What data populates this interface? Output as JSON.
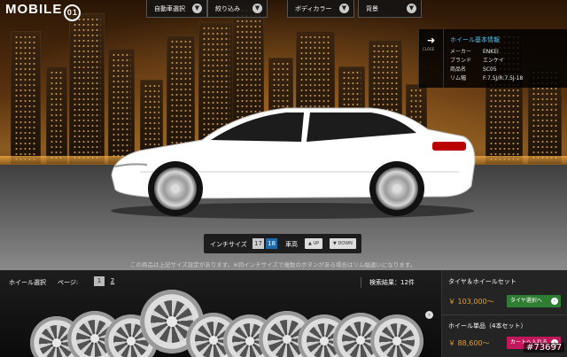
{
  "logo": {
    "text": "MOBILE",
    "badge": "01"
  },
  "topnav": [
    {
      "label": "自動車選択",
      "icon": "chevron-down-icon"
    },
    {
      "label": "絞り込み",
      "icon": "chevron-down-icon"
    },
    {
      "label": "ボディカラー",
      "icon": "chevron-down-icon"
    },
    {
      "label": "背景",
      "icon": "chevron-down-icon"
    }
  ],
  "info_panel": {
    "close_label": "CLOSE",
    "title": "ホイール基本情報",
    "rows": [
      {
        "key": "メーカー",
        "value": "ENKEI"
      },
      {
        "key": "ブランド",
        "value": "エンケイ"
      },
      {
        "key": "商品名",
        "value": "SC05"
      },
      {
        "key": "リム幅",
        "value": "F:7.5J/R:7.5J-18"
      }
    ]
  },
  "size_controls": {
    "inch_label": "インチサイズ",
    "sizes": [
      "17",
      "18"
    ],
    "selected_size": "18",
    "height_label": "車高",
    "up_label": "UP",
    "down_label": "DOWN"
  },
  "notice": "この商品は上記サイズ設定があります。※同インチサイズで複数のボタンがある場合はリム幅違いになります。",
  "wheel_select": {
    "header": "ホイール選択",
    "page_label": "ページ:",
    "pages": [
      "1",
      "2"
    ],
    "current_page": "1",
    "result_count": "検索結果：12件"
  },
  "sidebar": {
    "set_title": "タイヤ＆ホイールセット",
    "set_price": "￥ 103,000〜",
    "set_button": "タイヤ選択へ",
    "single_title": "ホイール単品（4本セット）",
    "single_price": "￥ 88,600〜",
    "single_button": "カートへ入れる"
  },
  "watermark": "#73697",
  "colors": {
    "accent_blue": "#4fc3f7",
    "price": "#e0a030",
    "green_button": "#2e7d32",
    "pink_button": "#c2185b",
    "car_body": "#ffffff"
  }
}
